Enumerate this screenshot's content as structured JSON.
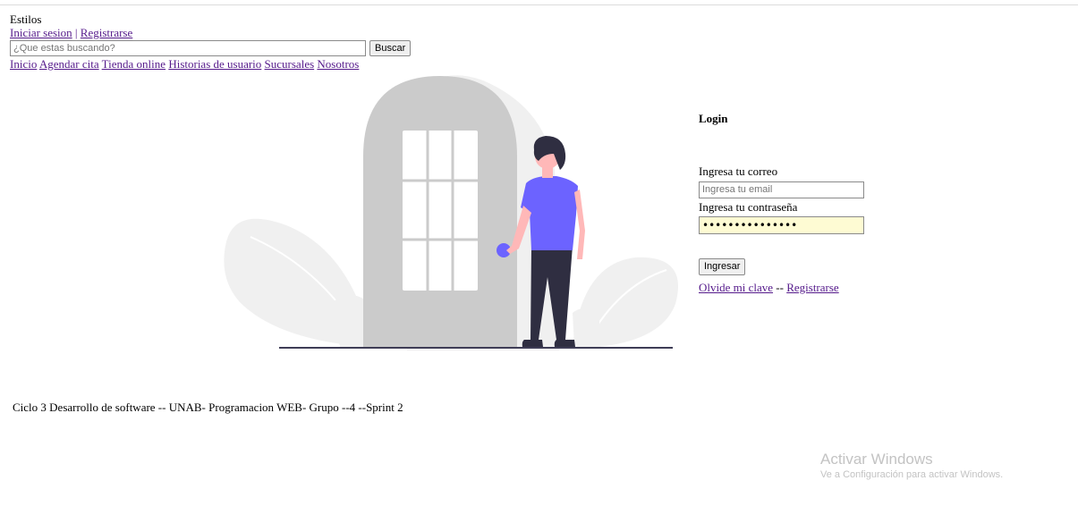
{
  "header": {
    "brand": "Estilos",
    "login_link": "Iniciar sesion",
    "separator": "|",
    "register_link": "Registrarse"
  },
  "search": {
    "placeholder": "¿Que estas buscando?",
    "button_label": "Buscar"
  },
  "nav": {
    "items": [
      "Inicio",
      "Agendar cita",
      "Tienda online",
      "Historias de usuario",
      "Sucursales",
      "Nosotros"
    ]
  },
  "login": {
    "title": "Login",
    "email_label": "Ingresa tu correo",
    "email_placeholder": "Ingresa tu email",
    "password_label": "Ingresa tu contraseña",
    "password_value": "•••••••••••••••",
    "submit_label": "Ingresar",
    "forgot_link": "Olvide mi clave",
    "links_separator": "--",
    "register_link": "Registrarse"
  },
  "footer": {
    "text": "Ciclo 3 Desarrollo de software -- UNAB- Programacion WEB- Grupo --4 --Sprint 2"
  },
  "watermark": {
    "title": "Activar Windows",
    "subtitle": "Ve a Configuración para activar Windows."
  },
  "illustration": {
    "shirt_color": "#6c63ff",
    "door_color": "#cbcbcb",
    "leaf_color": "#f0f0f0"
  }
}
